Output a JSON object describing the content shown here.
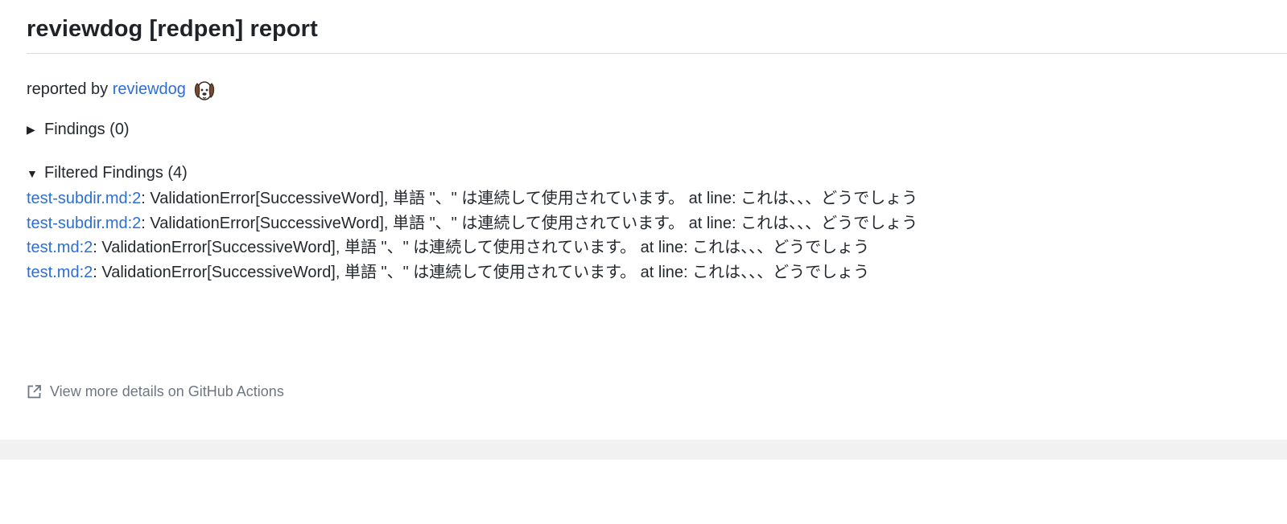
{
  "report": {
    "title": "reviewdog [redpen] report",
    "reported_prefix": "reported by ",
    "reporter_link": "reviewdog",
    "reporter_icon": "dog-face-icon"
  },
  "sections": {
    "findings_label": "Findings (0)",
    "findings_state": "collapsed",
    "filtered_label": "Filtered Findings (4)",
    "filtered_state": "expanded"
  },
  "filtered_findings": [
    {
      "location": "test-subdir.md:2",
      "message": ": ValidationError[SuccessiveWord], 単語 \"、\" は連続して使用されています。 at line: これは、、、どうでしょう"
    },
    {
      "location": "test-subdir.md:2",
      "message": ": ValidationError[SuccessiveWord], 単語 \"、\" は連続して使用されています。 at line: これは、、、どうでしょう"
    },
    {
      "location": "test.md:2",
      "message": ": ValidationError[SuccessiveWord], 単語 \"、\" は連続して使用されています。 at line: これは、、、どうでしょう"
    },
    {
      "location": "test.md:2",
      "message": ": ValidationError[SuccessiveWord], 単語 \"、\" は連続して使用されています。 at line: これは、、、どうでしょう"
    }
  ],
  "footer": {
    "view_more_label": "View more details on GitHub Actions",
    "view_more_icon": "external-link-icon"
  },
  "colors": {
    "link": "#2b6fd6",
    "text": "#24292f",
    "muted": "#6e7781",
    "rule": "#d9dcdf",
    "band": "#f1f1f1"
  }
}
